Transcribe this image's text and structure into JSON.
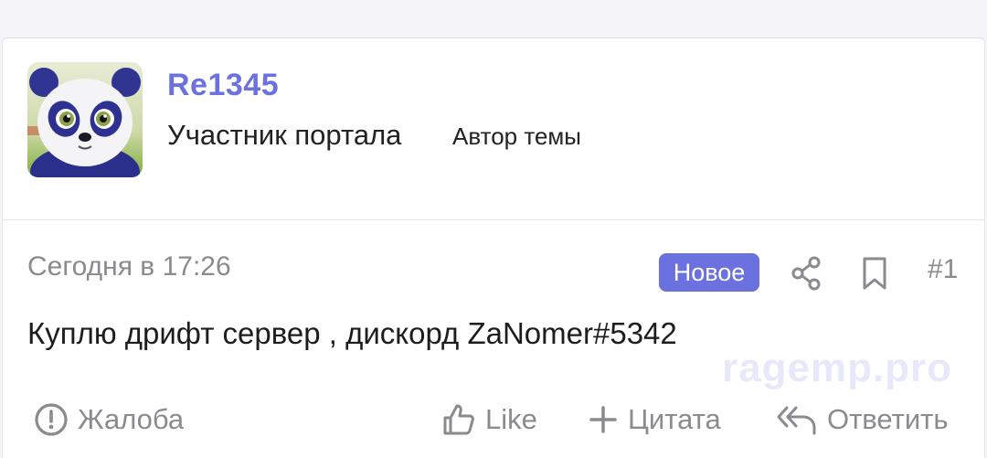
{
  "author": {
    "username": "Re1345",
    "user_title": "Участник портала",
    "badge": "Автор темы",
    "avatar_icon": "panda-avatar"
  },
  "post": {
    "date": "Сегодня в 17:26",
    "new_label": "Новое",
    "number": "#1",
    "body": "Куплю дрифт сервер , дискорд ZaNomer#5342"
  },
  "actions": {
    "report_label": "Жалоба",
    "like_label": "Like",
    "quote_label": "Цитата",
    "reply_label": "Ответить"
  },
  "watermark": "ragemp.pro",
  "colors": {
    "accent": "#6b72e0",
    "muted": "#8a8a8f",
    "text": "#1d1d1f"
  }
}
